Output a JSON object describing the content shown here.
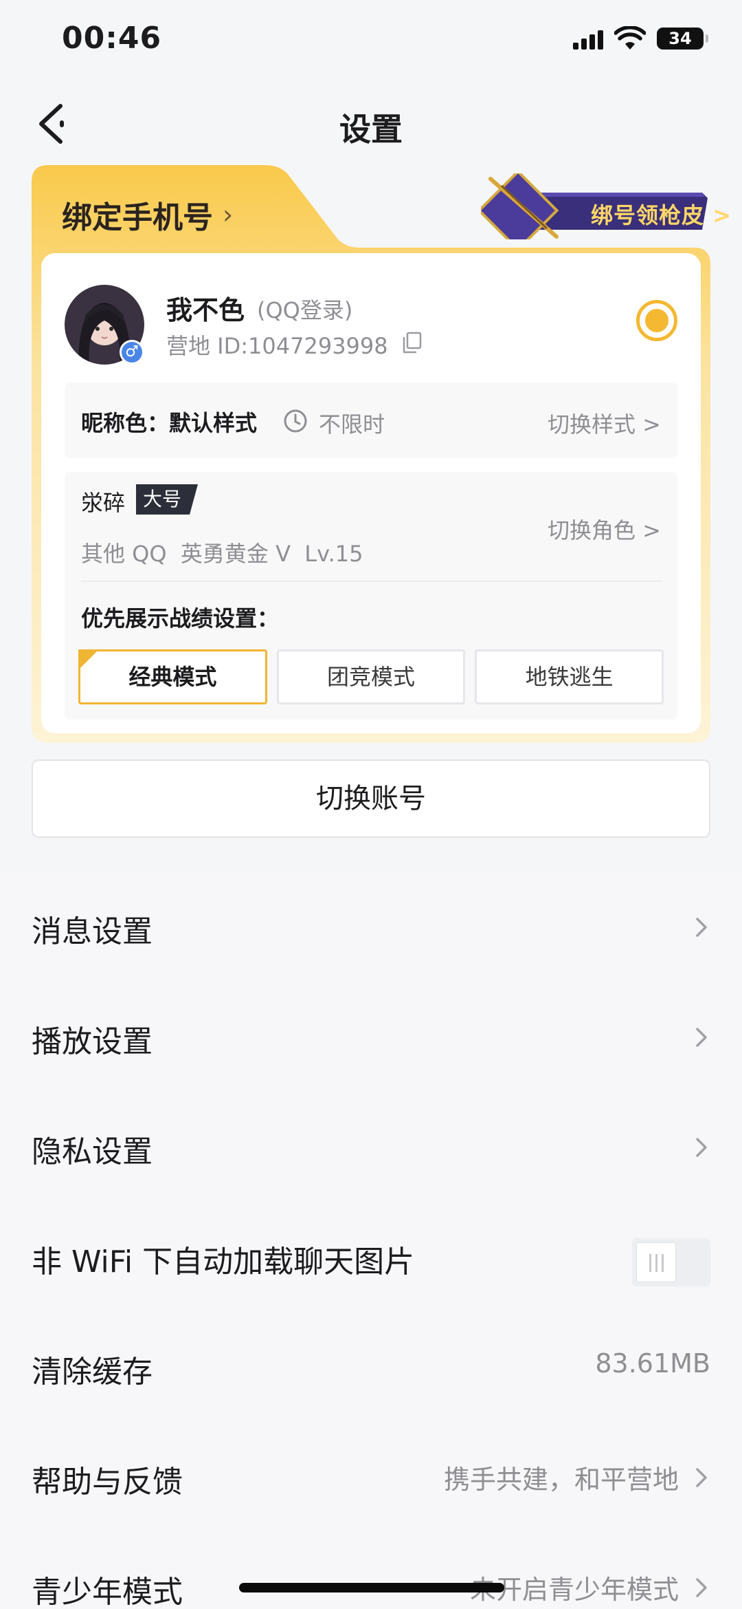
{
  "status_bar": {
    "time": "00:46",
    "battery": "34",
    "icons": [
      "signal-icon",
      "wifi-icon",
      "battery-icon"
    ]
  },
  "nav": {
    "title": "设置",
    "back_icon": "chevron-left-icon"
  },
  "account_card": {
    "bind_phone_label": "绑定手机号",
    "promo_label": "绑号领枪皮 >",
    "nickname": "我不色",
    "login_type": "(QQ登录)",
    "camp_id": "营地 ID:1047293998",
    "nickname_color_label": "昵称色：默认样式",
    "nickname_color_time": "不限时",
    "switch_style_label": "切换样式 >",
    "role_name": "泶碎",
    "role_tag": "大号",
    "role_info": "其他 QQ  英勇黄金 V  Lv.15",
    "switch_role_label": "切换角色 >",
    "record_setting_title": "优先展示战绩设置：",
    "modes": [
      {
        "label": "经典模式",
        "selected": true
      },
      {
        "label": "团竞模式",
        "selected": false
      },
      {
        "label": "地铁逃生",
        "selected": false
      }
    ],
    "accent_color": "#f5b832"
  },
  "switch_account_label": "切换账号",
  "settings": [
    {
      "label": "消息设置",
      "value": "",
      "control": "chevron"
    },
    {
      "label": "播放设置",
      "value": "",
      "control": "chevron"
    },
    {
      "label": "隐私设置",
      "value": "",
      "control": "chevron"
    },
    {
      "label": "非 WiFi 下自动加载聊天图片",
      "value": "",
      "control": "toggle",
      "toggle_on": false
    },
    {
      "label": "清除缓存",
      "value": "83.61MB",
      "control": "none"
    },
    {
      "label": "帮助与反馈",
      "value": "携手共建，和平营地",
      "control": "chevron"
    },
    {
      "label": "青少年模式",
      "value": "未开启青少年模式",
      "control": "chevron"
    }
  ]
}
